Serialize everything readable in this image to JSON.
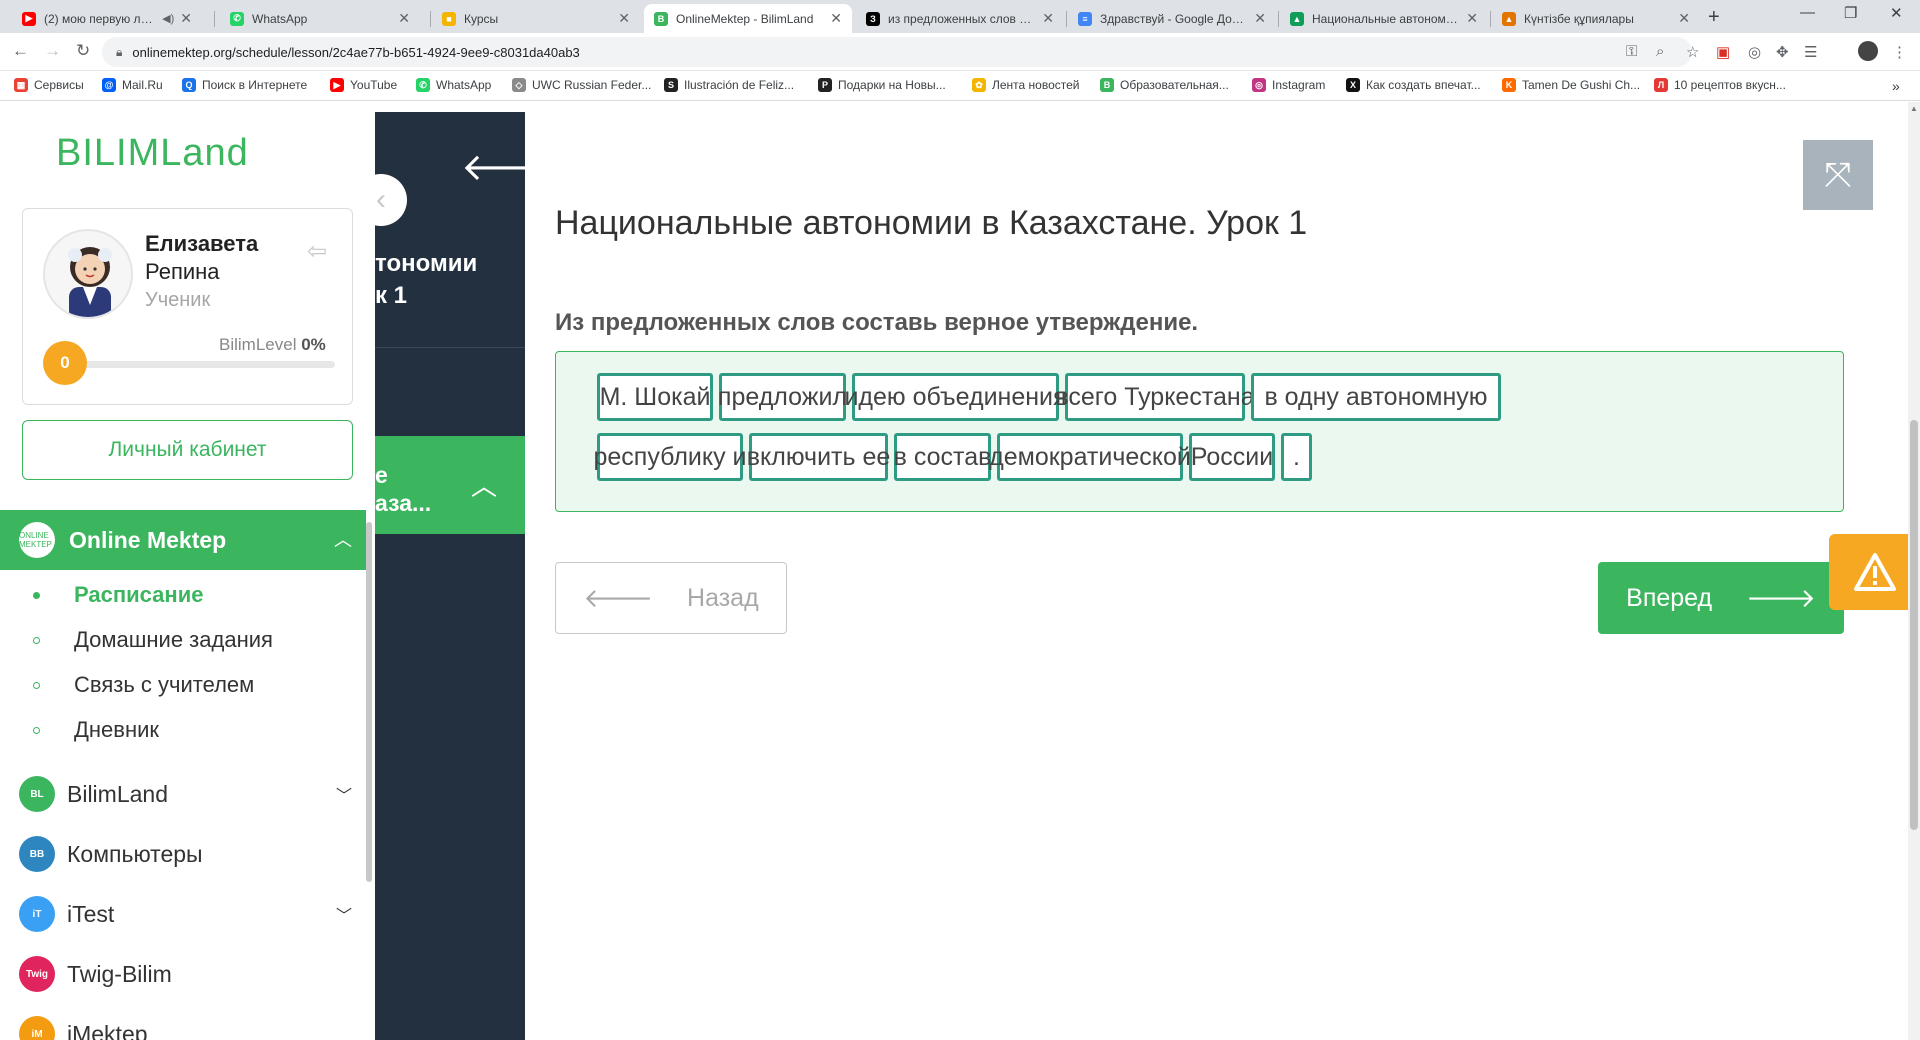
{
  "browser": {
    "tabs": [
      {
        "title": "(2) мою первую любов...",
        "favicon_color": "#ff0000",
        "favicon_text": "▶"
      },
      {
        "title": "WhatsApp",
        "favicon_color": "#25d366",
        "favicon_text": "✆"
      },
      {
        "title": "Курсы",
        "favicon_color": "#f4b400",
        "favicon_text": "■"
      },
      {
        "title": "OnlineMektep - BilimLand",
        "favicon_color": "#3cb55f",
        "favicon_text": "B"
      },
      {
        "title": "из предложенных слов со...",
        "favicon_color": "#000000",
        "favicon_text": "З"
      },
      {
        "title": "Здравствуй - Google Доку...",
        "favicon_color": "#4285f4",
        "favicon_text": "≡"
      },
      {
        "title": "Национальные автономи...",
        "favicon_color": "#0f9d58",
        "favicon_text": "▲"
      },
      {
        "title": "Күнтізбе құпиялары",
        "favicon_color": "#e37400",
        "favicon_text": "▲"
      }
    ],
    "url": "onlinemektep.org/schedule/lesson/2c4ae77b-b651-4924-9ee9-c8031da40ab3",
    "bookmarks": [
      {
        "label": "Сервисы",
        "color": "#ea4335",
        "glyph": "▦"
      },
      {
        "label": "Mail.Ru",
        "color": "#005ff9",
        "glyph": "@"
      },
      {
        "label": "Поиск в Интернете",
        "color": "#1a73e8",
        "glyph": "Q"
      },
      {
        "label": "YouTube",
        "color": "#ff0000",
        "glyph": "▶"
      },
      {
        "label": "WhatsApp",
        "color": "#25d366",
        "glyph": "✆"
      },
      {
        "label": "UWC Russian Feder...",
        "color": "#8a8a8a",
        "glyph": "◇"
      },
      {
        "label": "Ilustración de Feliz...",
        "color": "#222222",
        "glyph": "S"
      },
      {
        "label": "Подарки на Новы...",
        "color": "#222222",
        "glyph": "P"
      },
      {
        "label": "Лента новостей",
        "color": "#f4b400",
        "glyph": "✿"
      },
      {
        "label": "Образовательная...",
        "color": "#3cb55f",
        "glyph": "B"
      },
      {
        "label": "Instagram",
        "color": "#c13584",
        "glyph": "◎"
      },
      {
        "label": "Как создать впечат...",
        "color": "#111111",
        "glyph": "X"
      },
      {
        "label": "Tamen De Gushi Ch...",
        "color": "#ff6a00",
        "glyph": "K"
      },
      {
        "label": "10 рецептов вкусн...",
        "color": "#e53935",
        "glyph": "Л"
      }
    ]
  },
  "sidebar": {
    "logo": "BILIMLand",
    "user": {
      "first_name": "Елизавета",
      "last_name": "Репина",
      "role": "Ученик"
    },
    "level": {
      "value": "0",
      "label": "BilimLevel",
      "percent": "0%",
      "progress": 0
    },
    "cabinet_label": "Личный кабинет",
    "main_section": {
      "label": "Online Mektep",
      "icon_text": "ONLINE MEKTEP"
    },
    "sub_items": [
      {
        "label": "Расписание",
        "active": true
      },
      {
        "label": "Домашние задания",
        "active": false
      },
      {
        "label": "Связь с учителем",
        "active": false
      },
      {
        "label": "Дневник",
        "active": false
      }
    ],
    "modules": [
      {
        "label": "BilimLand",
        "color": "#3cb55f",
        "icon_text": "BL",
        "has_chevron": true
      },
      {
        "label": "Компьютеры",
        "color": "#2e86c1",
        "icon_text": "BB",
        "has_chevron": false
      },
      {
        "label": "iTest",
        "color": "#3aa0f3",
        "icon_text": "iT",
        "has_chevron": true
      },
      {
        "label": "Twig-Bilim",
        "color": "#e0245e",
        "icon_text": "Twig",
        "has_chevron": false
      },
      {
        "label": "iMektep",
        "color": "#f39c12",
        "icon_text": "iM",
        "has_chevron": false
      }
    ]
  },
  "lesson_panel": {
    "title_line1": "тономии",
    "title_line2": "к 1",
    "active_line1": "е",
    "active_line2": "аза..."
  },
  "main": {
    "lesson_title": "Национальные автономии в Казахстане. Урок 1",
    "task": "Из предложенных слов составь верное утверждение.",
    "words": [
      "М. Шокай",
      "предложил",
      "идею объединения",
      "всего Туркестана",
      "в одну автономную",
      "республику и",
      "включить ее",
      "в состав",
      "демократической",
      "России",
      "."
    ],
    "back_label": "Назад",
    "next_label": "Вперед"
  },
  "colors": {
    "brand_green": "#3cb55f",
    "dark_panel": "#22303f",
    "word_border": "#2f9b83",
    "warn_orange": "#f7a823"
  }
}
